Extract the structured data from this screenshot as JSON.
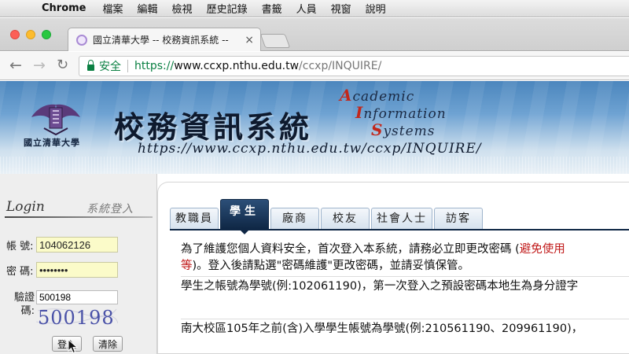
{
  "menubar": {
    "app": "Chrome",
    "items": [
      "檔案",
      "編輯",
      "檢視",
      "歷史記錄",
      "書籤",
      "人員",
      "視窗",
      "說明"
    ]
  },
  "browser": {
    "tab_title": "國立清華大學 -- 校務資訊系統 -- ",
    "tab_close": "×",
    "security_label": "安全",
    "url_proto": "https://",
    "url_host": "www.ccxp.nthu.edu.tw",
    "url_path": "/ccxp/INQUIRE/"
  },
  "banner": {
    "school_name": "國立清華大學",
    "system_title": "校務資訊系統",
    "eng_line1_cap": "A",
    "eng_line1_rest": "cademic",
    "eng_line2_cap": "I",
    "eng_line2_rest": "nformation",
    "eng_line3_cap": "S",
    "eng_line3_rest": "ystems",
    "url_art": "https://www.ccxp.nthu.edu.tw/ccxp/INQUIRE/"
  },
  "login": {
    "heading": "Login",
    "subheading": "系統登入",
    "account_label": "帳 號:",
    "account_value": "104062126",
    "password_label": "密 碼:",
    "password_value": "••••••••",
    "captcha_label": "驗證碼:",
    "captcha_value": "500198",
    "captcha_image_text": "500198",
    "login_button": "登入",
    "clear_button": "清除"
  },
  "user_tabs": [
    {
      "label": "教職員",
      "active": false
    },
    {
      "label": "學生",
      "active": true
    },
    {
      "label": "廠商",
      "active": false
    },
    {
      "label": "校友",
      "active": false
    },
    {
      "label": "社會人士",
      "active": false
    },
    {
      "label": "訪客",
      "active": false
    }
  ],
  "notice": {
    "line1_a": "為了維護您個人資料安全，首次登入本系統，請務必立即更改密碼 (",
    "line1_red": "避免使用",
    "line2_red": "等",
    "line2_b": ")。登入後請點選\"密碼維護\"更改密碼，並請妥慎保管。",
    "line3": "學生之帳號為學號(例:102061190)，第一次登入之預設密碼本地生為身分證字",
    "line4": "南大校區105年之前(含)入學學生帳號為學號(例:210561190、209961190)，"
  },
  "colors": {
    "accent_dark": "#0f2745",
    "secure_green": "#0b8043",
    "warning_red": "#c01818",
    "input_yellow": "#fbfbc9"
  }
}
